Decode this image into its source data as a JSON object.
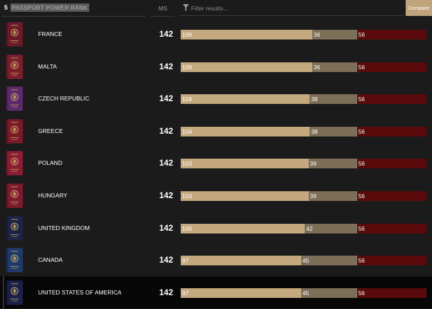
{
  "header": {
    "rank": "5",
    "title": "PASSPORT POWER RANK",
    "ms_label": "MS",
    "filter_placeholder": "Filter results...",
    "compare_label": "Compare"
  },
  "colors": {
    "visa_free": "#c4a97f",
    "visa_on_arrival": "#7d6e57",
    "visa_required": "#5a0a0a"
  },
  "rows": [
    {
      "country": "FRANCE",
      "ms": "142",
      "visa_free": "106",
      "visa_on_arrival": "36",
      "visa_required": "56",
      "passport_color": "#6b1a2a",
      "emblem": "crest-icon"
    },
    {
      "country": "MALTA",
      "ms": "142",
      "visa_free": "106",
      "visa_on_arrival": "36",
      "visa_required": "56",
      "passport_color": "#7a1e2c",
      "emblem": "crest-icon"
    },
    {
      "country": "CZECH REPUBLIC",
      "ms": "142",
      "visa_free": "104",
      "visa_on_arrival": "38",
      "visa_required": "56",
      "passport_color": "#5a2a6a",
      "emblem": "crest-icon"
    },
    {
      "country": "GREECE",
      "ms": "142",
      "visa_free": "104",
      "visa_on_arrival": "38",
      "visa_required": "56",
      "passport_color": "#7a1a28",
      "emblem": "crest-icon"
    },
    {
      "country": "POLAND",
      "ms": "142",
      "visa_free": "103",
      "visa_on_arrival": "39",
      "visa_required": "56",
      "passport_color": "#8a1c34",
      "emblem": "eagle-icon"
    },
    {
      "country": "HUNGARY",
      "ms": "142",
      "visa_free": "103",
      "visa_on_arrival": "39",
      "visa_required": "56",
      "passport_color": "#7e1a2e",
      "emblem": "crest-icon"
    },
    {
      "country": "UNITED KINGDOM",
      "ms": "142",
      "visa_free": "100",
      "visa_on_arrival": "42",
      "visa_required": "56",
      "passport_color": "#1c2345",
      "emblem": "royal-arms-icon"
    },
    {
      "country": "CANADA",
      "ms": "142",
      "visa_free": "97",
      "visa_on_arrival": "45",
      "visa_required": "56",
      "passport_color": "#1e3a6a",
      "emblem": "crest-icon"
    },
    {
      "country": "UNITED STATES OF AMERICA",
      "ms": "142",
      "visa_free": "97",
      "visa_on_arrival": "45",
      "visa_required": "56",
      "passport_color": "#1a2048",
      "emblem": "eagle-icon"
    }
  ],
  "highlighted_row": 8
}
